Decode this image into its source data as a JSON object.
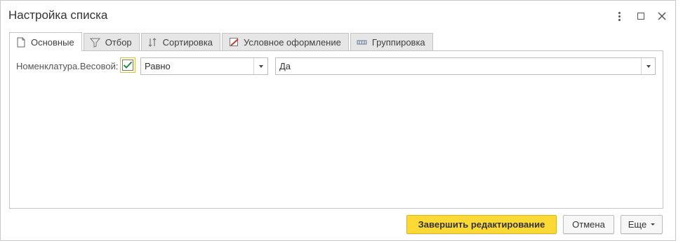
{
  "window": {
    "title": "Настройка списка"
  },
  "tabs": [
    {
      "label": "Основные",
      "icon": "page-icon",
      "active": true
    },
    {
      "label": "Отбор",
      "icon": "filter-icon",
      "active": false
    },
    {
      "label": "Сортировка",
      "icon": "sort-icon",
      "active": false
    },
    {
      "label": "Условное оформление",
      "icon": "conditional-format-icon",
      "active": false
    },
    {
      "label": "Группировка",
      "icon": "grouping-icon",
      "active": false
    }
  ],
  "filter_row": {
    "field_label": "Номенклатура.Весовой:",
    "enabled": true,
    "condition": "Равно",
    "value": "Да"
  },
  "buttons": {
    "finish": "Завершить редактирование",
    "cancel": "Отмена",
    "more": "Еще"
  },
  "colors": {
    "primary_button": "#fcd935",
    "check_mark": "#1f8a3a",
    "checkbox_focus": "#d9c24a"
  }
}
